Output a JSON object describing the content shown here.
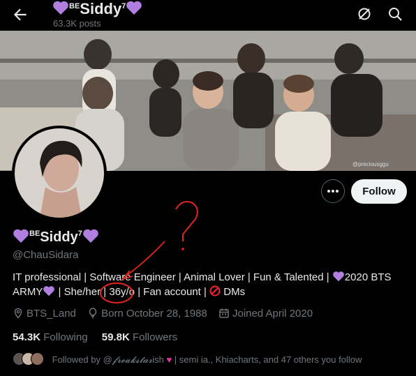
{
  "header": {
    "name_prefix": "BE",
    "name_main": "Siddy",
    "name_sup": "7",
    "posts": "63.3K posts"
  },
  "banner": {
    "watermark": "@preciousggu"
  },
  "actions": {
    "follow_label": "Follow"
  },
  "profile": {
    "name_prefix": "BE",
    "name_main": "Siddy",
    "name_sup": "7",
    "handle": "@ChauSidara",
    "bio_line1": "IT professional | Software Engineer | Animal Lover | Fun & Talented |",
    "bio_line1_tail": "2020 BTS",
    "bio_line2a": "ARMY",
    "bio_line2b": "| She/her |",
    "bio_age": "36y/o",
    "bio_line2c": "| Fan account |",
    "bio_line2d": "DMs",
    "location": "BTS_Land",
    "born": "Born October 28, 1988",
    "joined": "Joined April 2020"
  },
  "stats": {
    "following_count": "54.3K",
    "following_label": "Following",
    "followers_count": "59.8K",
    "followers_label": "Followers"
  },
  "followed_by": {
    "prefix": "Followed by @",
    "stylized": "𝓯𝓻𝓮𝓪𝓴𝓼𝓽𝓪𝓻",
    "name_tail": "ish",
    "rest": "| semi ia., Khiacharts, and 47 others you follow"
  },
  "annotation": {
    "mark": "?"
  },
  "colors": {
    "accent_heart": "#b07fe0",
    "annotation_red": "#e0261e",
    "follow_bg": "#eff3f4",
    "muted": "#71767b"
  }
}
